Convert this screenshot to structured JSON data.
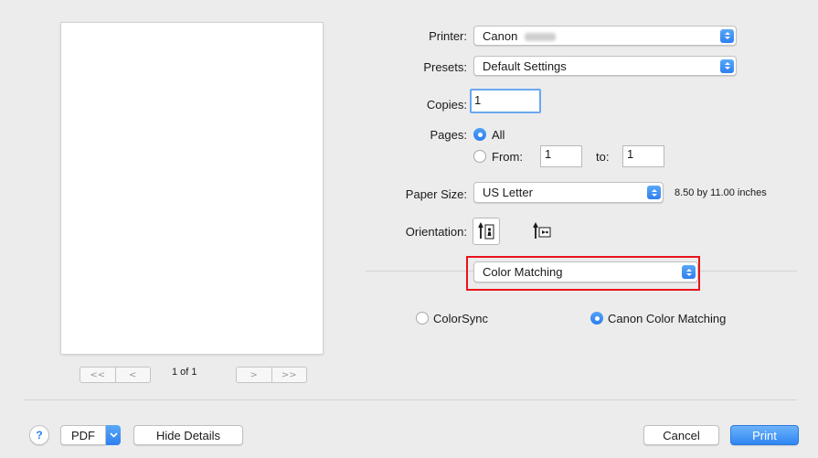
{
  "printer": {
    "label": "Printer:",
    "value": "Canon"
  },
  "presets": {
    "label": "Presets:",
    "value": "Default Settings"
  },
  "copies": {
    "label": "Copies:",
    "value": "1"
  },
  "pages": {
    "label": "Pages:",
    "all_label": "All",
    "from_label": "From:",
    "from_value": "1",
    "to_label": "to:",
    "to_value": "1",
    "selected": "All"
  },
  "paper_size": {
    "label": "Paper Size:",
    "value": "US Letter",
    "dimensions": "8.50 by 11.00 inches"
  },
  "orientation": {
    "label": "Orientation:",
    "selected": "portrait"
  },
  "panel": {
    "value": "Color Matching"
  },
  "color_matching": {
    "options": [
      "ColorSync",
      "Canon Color Matching"
    ],
    "selected": "Canon Color Matching"
  },
  "preview": {
    "page_indicator": "1 of 1",
    "first_glyph": "<<",
    "prev_glyph": "<",
    "next_glyph": ">",
    "last_glyph": ">>"
  },
  "footer": {
    "help_label": "?",
    "pdf_label": "PDF",
    "hide_details_label": "Hide Details",
    "cancel_label": "Cancel",
    "print_label": "Print"
  },
  "colors": {
    "accent": "#2f7ff0",
    "highlight_box": "#e8141a",
    "dialog_bg": "#ececec"
  }
}
